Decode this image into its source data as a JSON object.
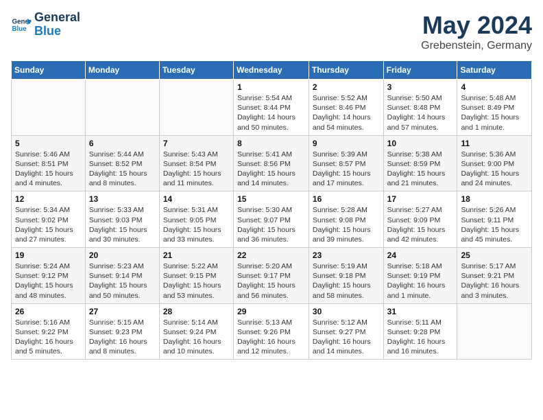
{
  "header": {
    "logo_line1": "General",
    "logo_line2": "Blue",
    "title": "May 2024",
    "subtitle": "Grebenstein, Germany"
  },
  "columns": [
    "Sunday",
    "Monday",
    "Tuesday",
    "Wednesday",
    "Thursday",
    "Friday",
    "Saturday"
  ],
  "weeks": [
    [
      {
        "day": "",
        "info": ""
      },
      {
        "day": "",
        "info": ""
      },
      {
        "day": "",
        "info": ""
      },
      {
        "day": "1",
        "info": "Sunrise: 5:54 AM\nSunset: 8:44 PM\nDaylight: 14 hours\nand 50 minutes."
      },
      {
        "day": "2",
        "info": "Sunrise: 5:52 AM\nSunset: 8:46 PM\nDaylight: 14 hours\nand 54 minutes."
      },
      {
        "day": "3",
        "info": "Sunrise: 5:50 AM\nSunset: 8:48 PM\nDaylight: 14 hours\nand 57 minutes."
      },
      {
        "day": "4",
        "info": "Sunrise: 5:48 AM\nSunset: 8:49 PM\nDaylight: 15 hours\nand 1 minute."
      }
    ],
    [
      {
        "day": "5",
        "info": "Sunrise: 5:46 AM\nSunset: 8:51 PM\nDaylight: 15 hours\nand 4 minutes."
      },
      {
        "day": "6",
        "info": "Sunrise: 5:44 AM\nSunset: 8:52 PM\nDaylight: 15 hours\nand 8 minutes."
      },
      {
        "day": "7",
        "info": "Sunrise: 5:43 AM\nSunset: 8:54 PM\nDaylight: 15 hours\nand 11 minutes."
      },
      {
        "day": "8",
        "info": "Sunrise: 5:41 AM\nSunset: 8:56 PM\nDaylight: 15 hours\nand 14 minutes."
      },
      {
        "day": "9",
        "info": "Sunrise: 5:39 AM\nSunset: 8:57 PM\nDaylight: 15 hours\nand 17 minutes."
      },
      {
        "day": "10",
        "info": "Sunrise: 5:38 AM\nSunset: 8:59 PM\nDaylight: 15 hours\nand 21 minutes."
      },
      {
        "day": "11",
        "info": "Sunrise: 5:36 AM\nSunset: 9:00 PM\nDaylight: 15 hours\nand 24 minutes."
      }
    ],
    [
      {
        "day": "12",
        "info": "Sunrise: 5:34 AM\nSunset: 9:02 PM\nDaylight: 15 hours\nand 27 minutes."
      },
      {
        "day": "13",
        "info": "Sunrise: 5:33 AM\nSunset: 9:03 PM\nDaylight: 15 hours\nand 30 minutes."
      },
      {
        "day": "14",
        "info": "Sunrise: 5:31 AM\nSunset: 9:05 PM\nDaylight: 15 hours\nand 33 minutes."
      },
      {
        "day": "15",
        "info": "Sunrise: 5:30 AM\nSunset: 9:07 PM\nDaylight: 15 hours\nand 36 minutes."
      },
      {
        "day": "16",
        "info": "Sunrise: 5:28 AM\nSunset: 9:08 PM\nDaylight: 15 hours\nand 39 minutes."
      },
      {
        "day": "17",
        "info": "Sunrise: 5:27 AM\nSunset: 9:09 PM\nDaylight: 15 hours\nand 42 minutes."
      },
      {
        "day": "18",
        "info": "Sunrise: 5:26 AM\nSunset: 9:11 PM\nDaylight: 15 hours\nand 45 minutes."
      }
    ],
    [
      {
        "day": "19",
        "info": "Sunrise: 5:24 AM\nSunset: 9:12 PM\nDaylight: 15 hours\nand 48 minutes."
      },
      {
        "day": "20",
        "info": "Sunrise: 5:23 AM\nSunset: 9:14 PM\nDaylight: 15 hours\nand 50 minutes."
      },
      {
        "day": "21",
        "info": "Sunrise: 5:22 AM\nSunset: 9:15 PM\nDaylight: 15 hours\nand 53 minutes."
      },
      {
        "day": "22",
        "info": "Sunrise: 5:20 AM\nSunset: 9:17 PM\nDaylight: 15 hours\nand 56 minutes."
      },
      {
        "day": "23",
        "info": "Sunrise: 5:19 AM\nSunset: 9:18 PM\nDaylight: 15 hours\nand 58 minutes."
      },
      {
        "day": "24",
        "info": "Sunrise: 5:18 AM\nSunset: 9:19 PM\nDaylight: 16 hours\nand 1 minute."
      },
      {
        "day": "25",
        "info": "Sunrise: 5:17 AM\nSunset: 9:21 PM\nDaylight: 16 hours\nand 3 minutes."
      }
    ],
    [
      {
        "day": "26",
        "info": "Sunrise: 5:16 AM\nSunset: 9:22 PM\nDaylight: 16 hours\nand 5 minutes."
      },
      {
        "day": "27",
        "info": "Sunrise: 5:15 AM\nSunset: 9:23 PM\nDaylight: 16 hours\nand 8 minutes."
      },
      {
        "day": "28",
        "info": "Sunrise: 5:14 AM\nSunset: 9:24 PM\nDaylight: 16 hours\nand 10 minutes."
      },
      {
        "day": "29",
        "info": "Sunrise: 5:13 AM\nSunset: 9:26 PM\nDaylight: 16 hours\nand 12 minutes."
      },
      {
        "day": "30",
        "info": "Sunrise: 5:12 AM\nSunset: 9:27 PM\nDaylight: 16 hours\nand 14 minutes."
      },
      {
        "day": "31",
        "info": "Sunrise: 5:11 AM\nSunset: 9:28 PM\nDaylight: 16 hours\nand 16 minutes."
      },
      {
        "day": "",
        "info": ""
      }
    ]
  ]
}
